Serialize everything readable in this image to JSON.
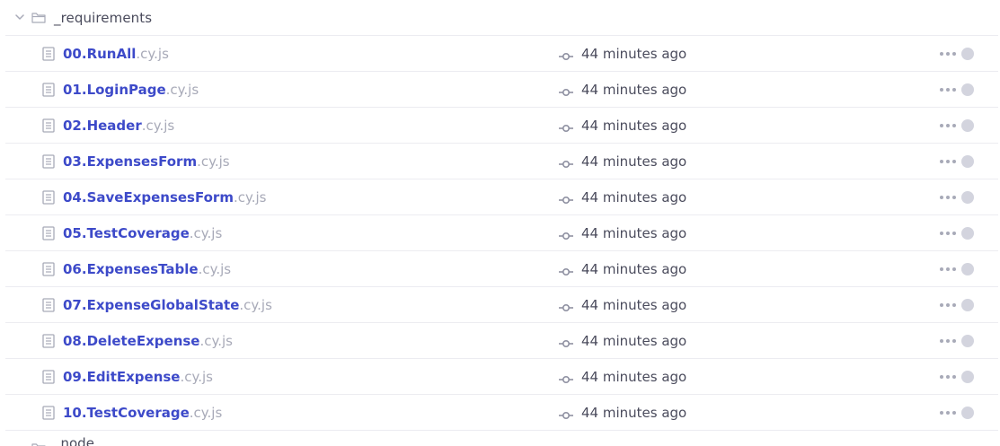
{
  "folder": {
    "name": "_requirements",
    "expanded": true
  },
  "files": [
    {
      "base": "00.RunAll",
      "ext": ".cy.js",
      "time": "44 minutes ago"
    },
    {
      "base": "01.LoginPage",
      "ext": ".cy.js",
      "time": "44 minutes ago"
    },
    {
      "base": "02.Header",
      "ext": ".cy.js",
      "time": "44 minutes ago"
    },
    {
      "base": "03.ExpensesForm",
      "ext": ".cy.js",
      "time": "44 minutes ago"
    },
    {
      "base": "04.SaveExpensesForm",
      "ext": ".cy.js",
      "time": "44 minutes ago"
    },
    {
      "base": "05.TestCoverage",
      "ext": ".cy.js",
      "time": "44 minutes ago"
    },
    {
      "base": "06.ExpensesTable",
      "ext": ".cy.js",
      "time": "44 minutes ago"
    },
    {
      "base": "07.ExpenseGlobalState",
      "ext": ".cy.js",
      "time": "44 minutes ago"
    },
    {
      "base": "08.DeleteExpense",
      "ext": ".cy.js",
      "time": "44 minutes ago"
    },
    {
      "base": "09.EditExpense",
      "ext": ".cy.js",
      "time": "44 minutes ago"
    },
    {
      "base": "10.TestCoverage",
      "ext": ".cy.js",
      "time": "44 minutes ago"
    }
  ],
  "next_folder": {
    "name": "_node"
  },
  "colors": {
    "file_name": "#3d4ac9",
    "file_ext": "#a8aab8",
    "text": "#4a4b5c",
    "icon": "#a8aab8",
    "status_dot": "#d3d4de"
  }
}
